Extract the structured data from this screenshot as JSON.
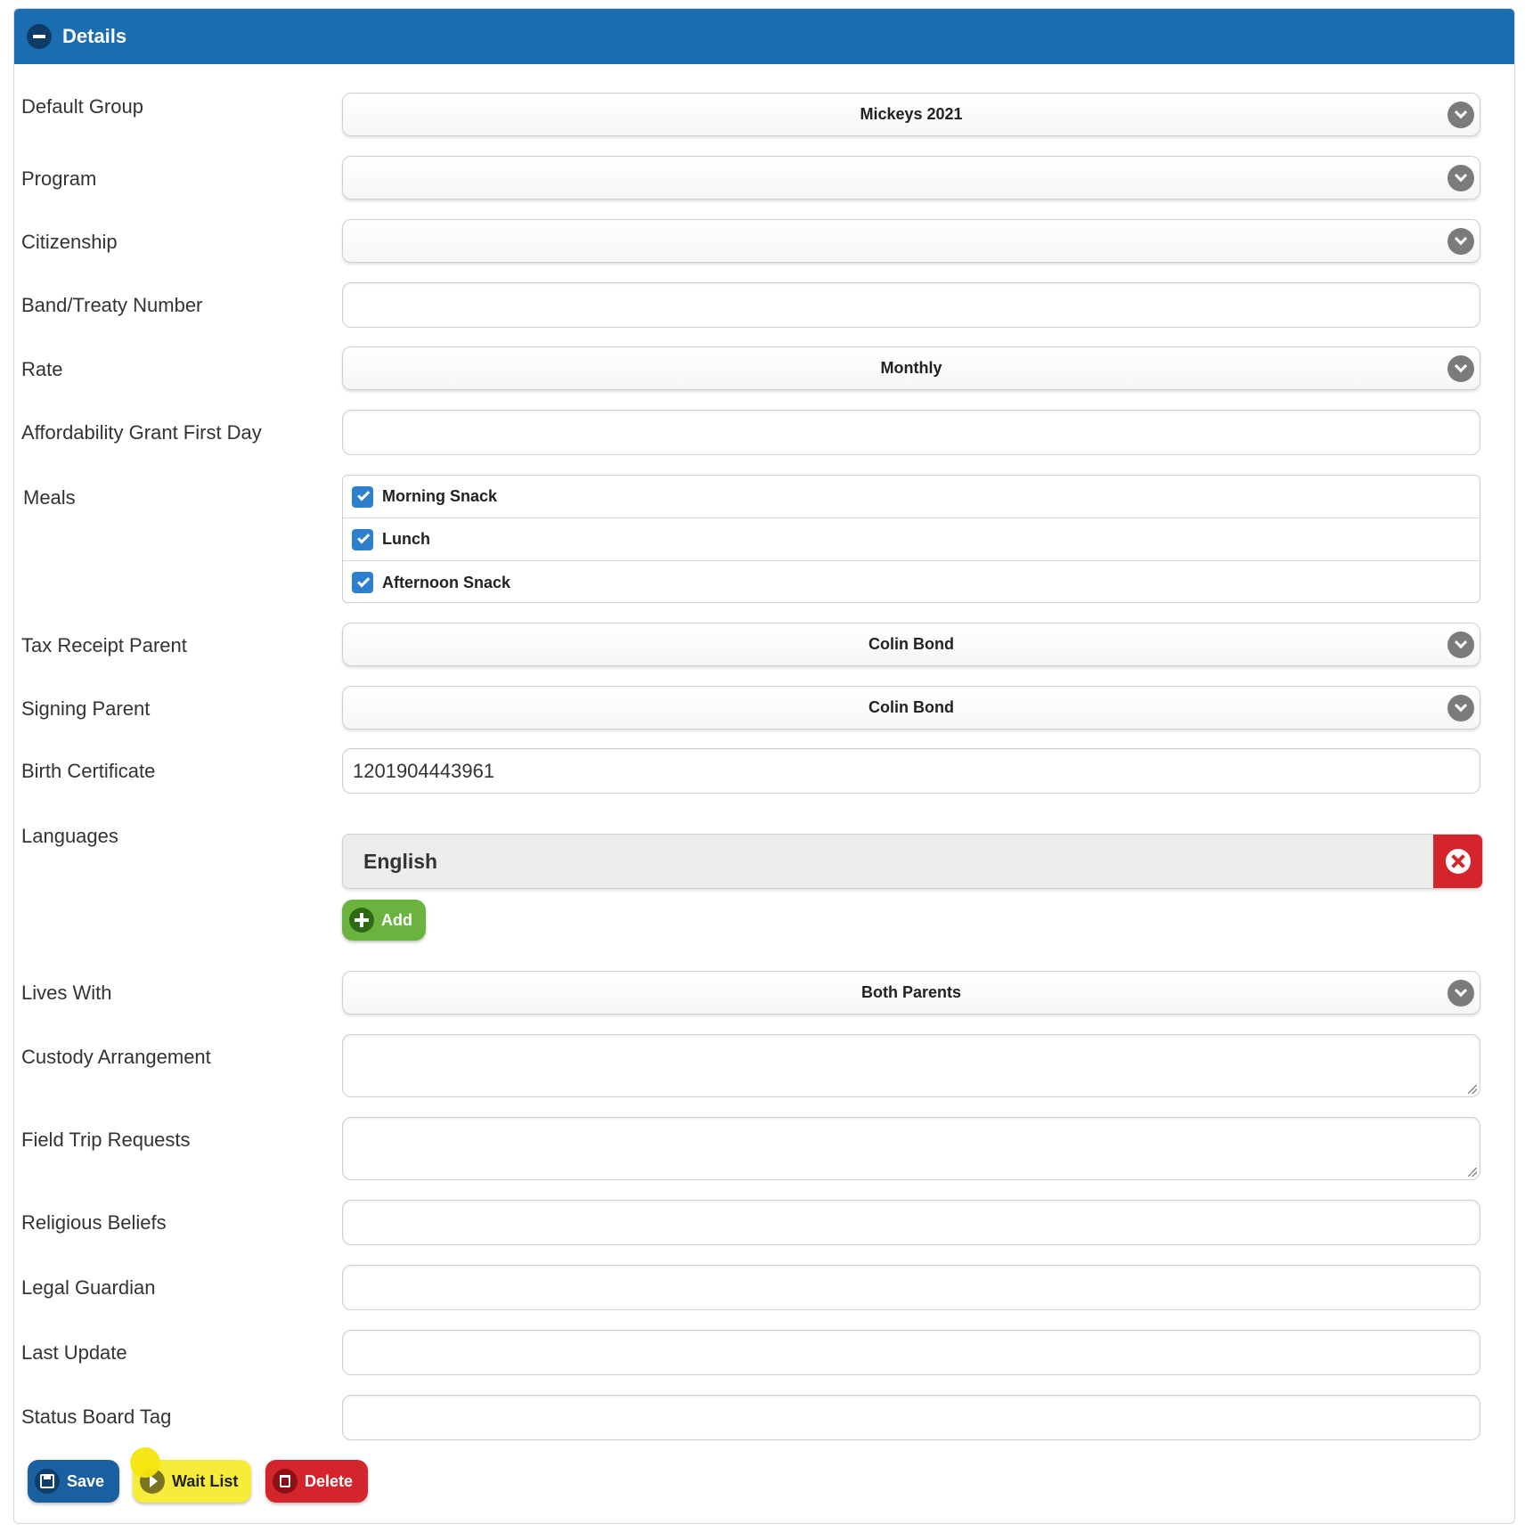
{
  "panel": {
    "title": "Details"
  },
  "fields": {
    "default_group": {
      "label": "Default Group",
      "value": "Mickeys 2021"
    },
    "program": {
      "label": "Program",
      "value": ""
    },
    "citizenship": {
      "label": "Citizenship",
      "value": ""
    },
    "band_treaty_number": {
      "label": "Band/Treaty Number",
      "value": ""
    },
    "rate": {
      "label": "Rate",
      "value": "Monthly"
    },
    "affordability_grant_first_day": {
      "label": "Affordability Grant First Day",
      "value": ""
    },
    "meals": {
      "label": "Meals",
      "options": [
        {
          "label": "Morning Snack",
          "checked": true
        },
        {
          "label": "Lunch",
          "checked": true
        },
        {
          "label": "Afternoon Snack",
          "checked": true
        }
      ]
    },
    "tax_receipt_parent": {
      "label": "Tax Receipt Parent",
      "value": "Colin Bond"
    },
    "signing_parent": {
      "label": "Signing Parent",
      "value": "Colin Bond"
    },
    "birth_certificate": {
      "label": "Birth Certificate",
      "value": "1201904443961"
    },
    "languages": {
      "label": "Languages",
      "items": [
        "English"
      ],
      "add_label": "Add"
    },
    "lives_with": {
      "label": "Lives With",
      "value": "Both Parents"
    },
    "custody_arrangement": {
      "label": "Custody Arrangement",
      "value": ""
    },
    "field_trip_requests": {
      "label": "Field Trip Requests",
      "value": ""
    },
    "religious_beliefs": {
      "label": "Religious Beliefs",
      "value": ""
    },
    "legal_guardian": {
      "label": "Legal Guardian",
      "value": ""
    },
    "last_update": {
      "label": "Last Update",
      "value": ""
    },
    "status_board_tag": {
      "label": "Status Board Tag",
      "value": ""
    }
  },
  "actions": {
    "save_label": "Save",
    "waitlist_label": "Wait List",
    "delete_label": "Delete"
  },
  "colors": {
    "header": "#1a6db0",
    "save": "#1a5fa0",
    "waitlist": "#f7ec3a",
    "delete": "#d4252c",
    "add": "#6ab33e",
    "checkbox": "#2f7fd0"
  },
  "icons": {
    "header": "minus-circle-icon",
    "select": "chevron-down-icon",
    "remove_language": "close-icon",
    "add": "plus-circle-icon",
    "save": "floppy-disk-icon",
    "waitlist": "arrow-right-circle-icon",
    "delete": "trash-icon"
  }
}
